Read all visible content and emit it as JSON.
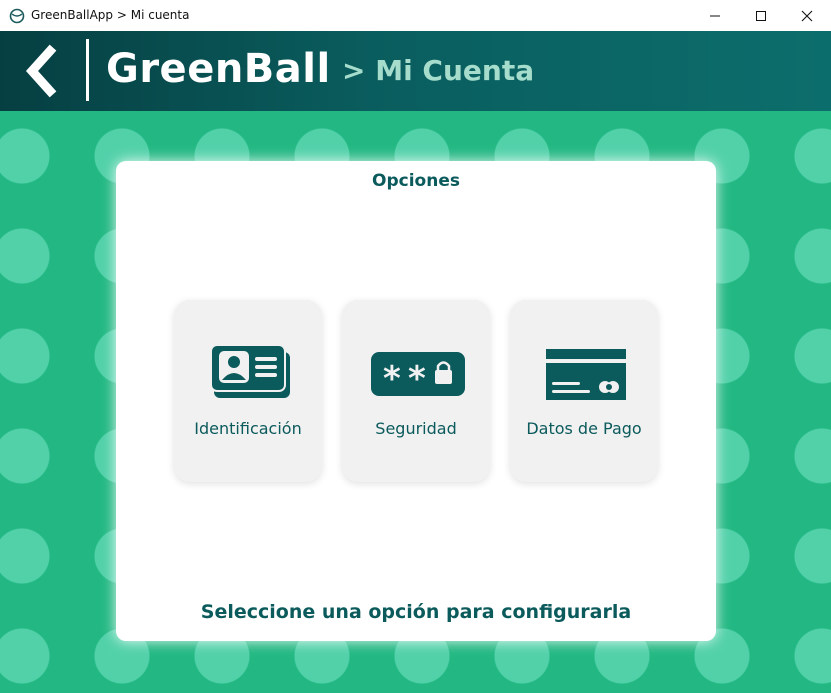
{
  "window": {
    "title": "GreenBallApp > Mi cuenta",
    "minimize_glyph": "—",
    "maximize_glyph": "☐",
    "close_glyph": "✕"
  },
  "header": {
    "brand": "GreenBall",
    "crumb": "> Mi Cuenta",
    "back_icon": "chevron-left-icon"
  },
  "panel": {
    "title": "Opciones",
    "options": [
      {
        "label": "Identificación",
        "icon": "id-card-icon"
      },
      {
        "label": "Seguridad",
        "icon": "password-icon"
      },
      {
        "label": "Datos de Pago",
        "icon": "credit-card-icon"
      }
    ],
    "hint": "Seleccione una opción para configurarla"
  },
  "colors": {
    "header_dark": "#063f42",
    "header_light": "#0c6e6c",
    "background_green": "#23b883",
    "accent_teal": "#0b5a5c",
    "option_bg": "#f1f1f1"
  }
}
